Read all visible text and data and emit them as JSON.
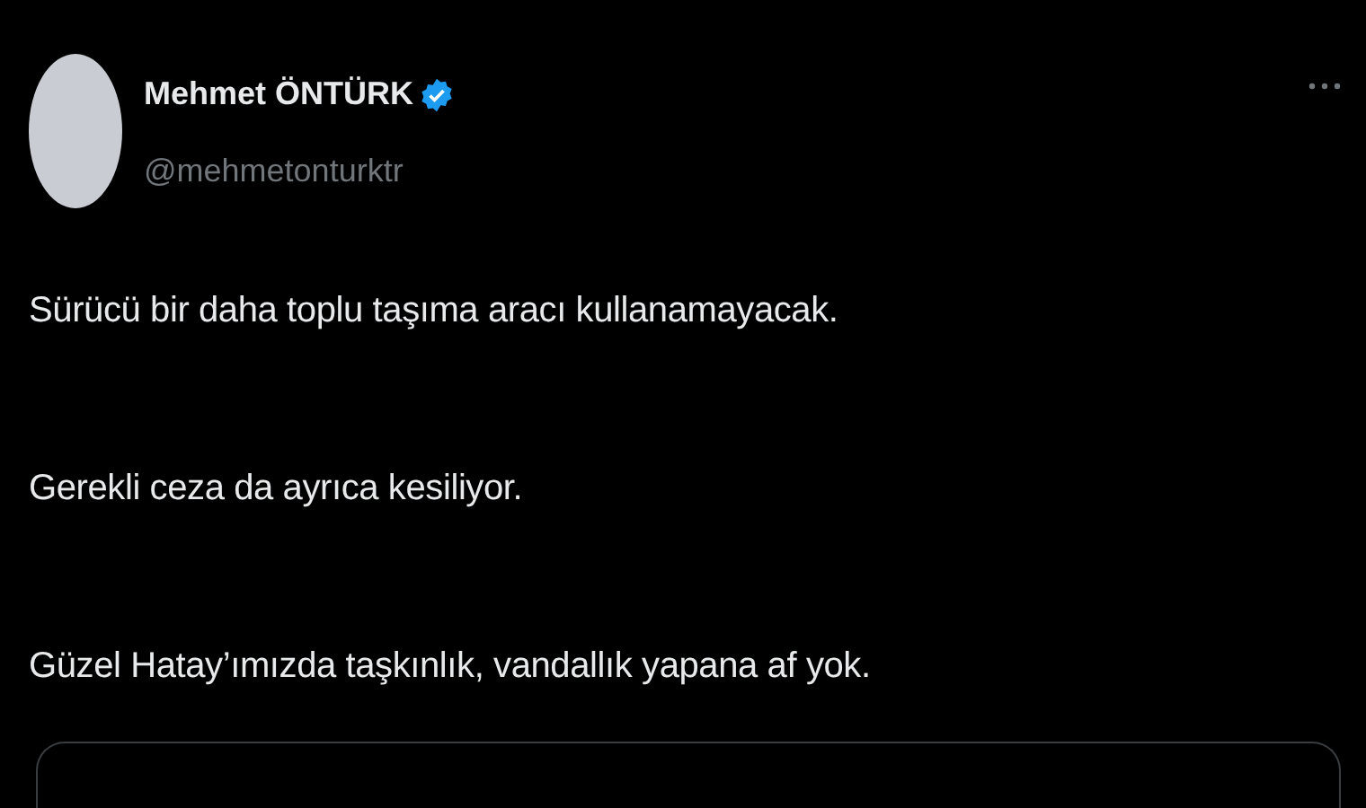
{
  "author": {
    "name": "Mehmet ÖNTÜRK",
    "verified": true,
    "handle": "@mehmetonturktr"
  },
  "paragraphs": [
    "Sürücü bir daha toplu taşıma aracı kullanamayacak.",
    "Gerekli ceza da ayrıca kesiliyor.",
    "Güzel Hatay’ımızda taşkınlık, vandallık yapana af yok."
  ]
}
